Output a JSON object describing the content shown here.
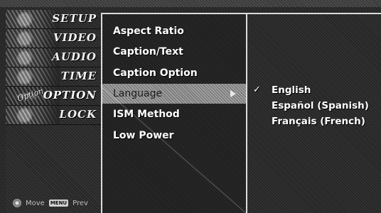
{
  "sidebar": {
    "categories": [
      {
        "label": "SETUP"
      },
      {
        "label": "VIDEO"
      },
      {
        "label": "AUDIO"
      },
      {
        "label": "TIME"
      },
      {
        "label": "OPTION",
        "badge": "Option"
      },
      {
        "label": "LOCK"
      }
    ],
    "hints": {
      "move": "Move",
      "menu_key": "MENU",
      "prev": "Prev"
    }
  },
  "options": {
    "items": [
      {
        "label": "Aspect Ratio"
      },
      {
        "label": "Caption/Text"
      },
      {
        "label": "Caption Option"
      },
      {
        "label": "Language"
      },
      {
        "label": "ISM Method"
      },
      {
        "label": "Low Power"
      }
    ]
  },
  "submenu": {
    "check": "✓",
    "items": [
      {
        "label": "English"
      },
      {
        "label": "Español (Spanish)"
      },
      {
        "label": "Français (French)"
      }
    ]
  },
  "icons": {
    "category_thumbs": "category-thumbnail-icon",
    "arrow": "right-arrow-icon",
    "check": "check-icon",
    "move": "dpad-icon"
  },
  "colors": {
    "selected_row": "#8c8c8c",
    "text": "#ffffff",
    "divider": "#dcdcdc"
  }
}
